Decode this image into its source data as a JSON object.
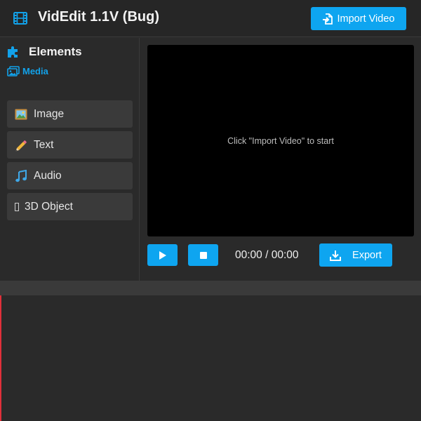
{
  "header": {
    "title": "VidEdit 1.1V (Bug)",
    "import_label": "Import Video",
    "app_icon": "film-icon",
    "import_icon": "file-import-icon"
  },
  "sidebar": {
    "title": "Elements",
    "title_icon": "puzzle-icon",
    "tab_label": "Media",
    "tab_icon": "images-icon",
    "items": [
      {
        "label": "Image",
        "icon": "framed-picture-emoji"
      },
      {
        "label": "Text",
        "icon": "pencil-emoji"
      },
      {
        "label": "Audio",
        "icon": "musical-note-emoji"
      },
      {
        "label": "3D Object",
        "icon": "missing-glyph"
      }
    ]
  },
  "preview": {
    "hint": "Click \"Import Video\" to start"
  },
  "controls": {
    "time": "00:00 / 00:00",
    "export_label": "Export",
    "play_icon": "play-icon",
    "stop_icon": "stop-icon",
    "export_icon": "download-icon"
  },
  "colors": {
    "accent": "#0ea5f0",
    "background": "#2a2a2a",
    "panel": "#3a3a3a",
    "playhead": "#e0303a"
  }
}
